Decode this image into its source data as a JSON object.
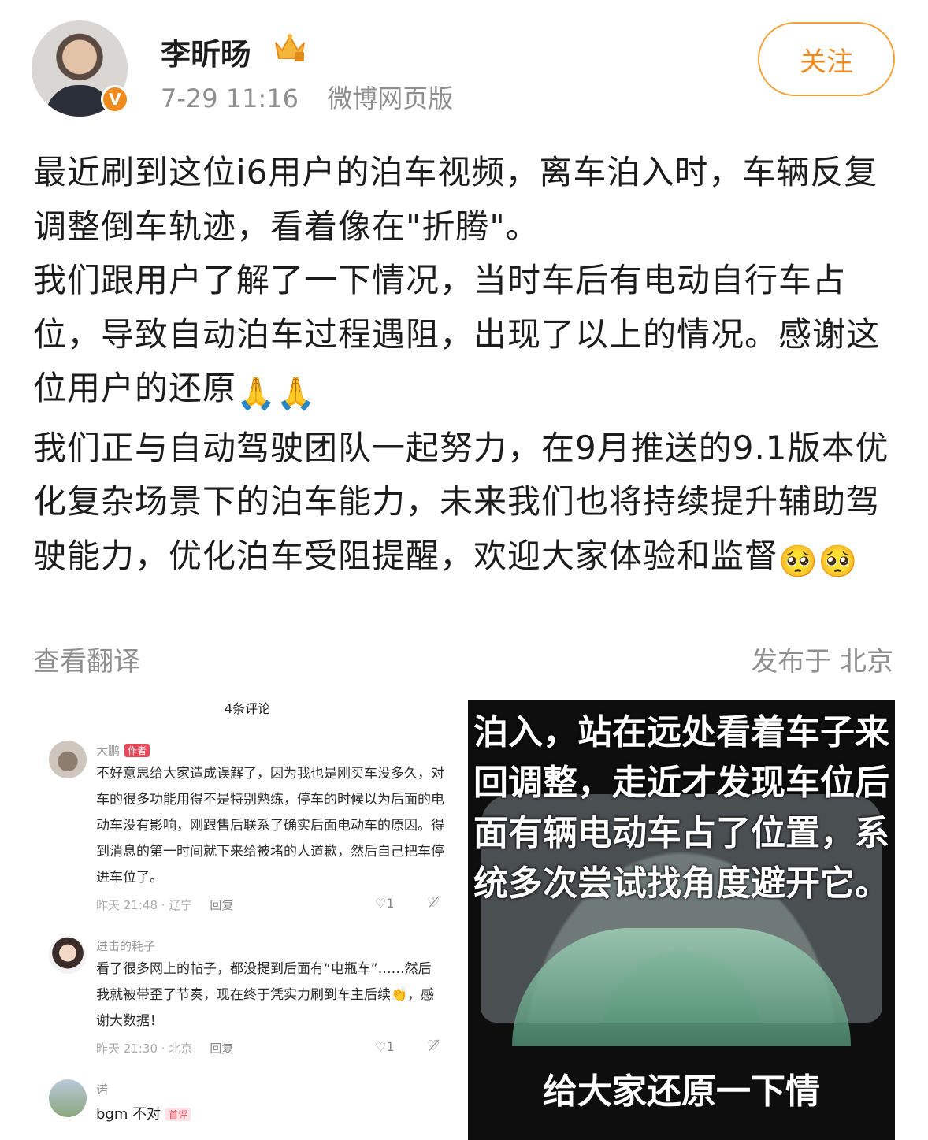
{
  "header": {
    "username": "李昕旸",
    "timestamp": "7-29 11:16",
    "source": "微博网页版",
    "follow_label": "关注",
    "verified_badge": "V"
  },
  "post": {
    "paragraphs": [
      "最近刷到这位i6用户的泊车视频，离车泊入时，车辆反复调整倒车轨迹，看着像在\"折腾\"。",
      "我们跟用户了解了一下情况，当时车后有电动自行车占位，导致自动泊车过程遇阻，出现了以上的情况。感谢这位用户的还原",
      "我们正与自动驾驶团队一起努力，在9月推送的9.1版本优化复杂场景下的泊车能力，未来我们也将持续提升辅助驾驶能力，优化泊车受阻提醒，欢迎大家体验和监督"
    ],
    "emoji_pray": "🙏🙏",
    "emoji_plead": "🥺🥺",
    "translate_label": "查看翻译",
    "location_label": "发布于 北京"
  },
  "comments": {
    "title": "4条评论",
    "items": [
      {
        "name": "大鹏",
        "tag": "作者",
        "text": "不好意思给大家造成误解了，因为我也是刚买车没多久，对车的很多功能用得不是特别熟练，停车的时候以为后面的电动车没有影响，刚跟售后联系了确实后面电动车的原因。得到消息的第一时间就下来给被堵的人道歉，然后自己把车停进车位了。",
        "time": "昨天 21:48 · 辽宁",
        "reply": "回复",
        "likes": "1"
      },
      {
        "name": "进击的耗子",
        "text": "看了很多网上的帖子，都没提到后面有“电瓶车”……然后我就被带歪了节奏，现在终于凭实力刷到车主后续👏，感谢大数据！",
        "time": "昨天 21:30 · 北京",
        "reply": "回复",
        "likes": "1"
      },
      {
        "name": "诺",
        "text": "bgm 不对",
        "tag": "首评"
      }
    ]
  },
  "video": {
    "caption": "泊入，站在远处看着车子来回调整，走近才发现车位后面有辆电动车占了位置，系统多次尝试找角度避开它。",
    "caption2": "给大家还原一下情"
  }
}
